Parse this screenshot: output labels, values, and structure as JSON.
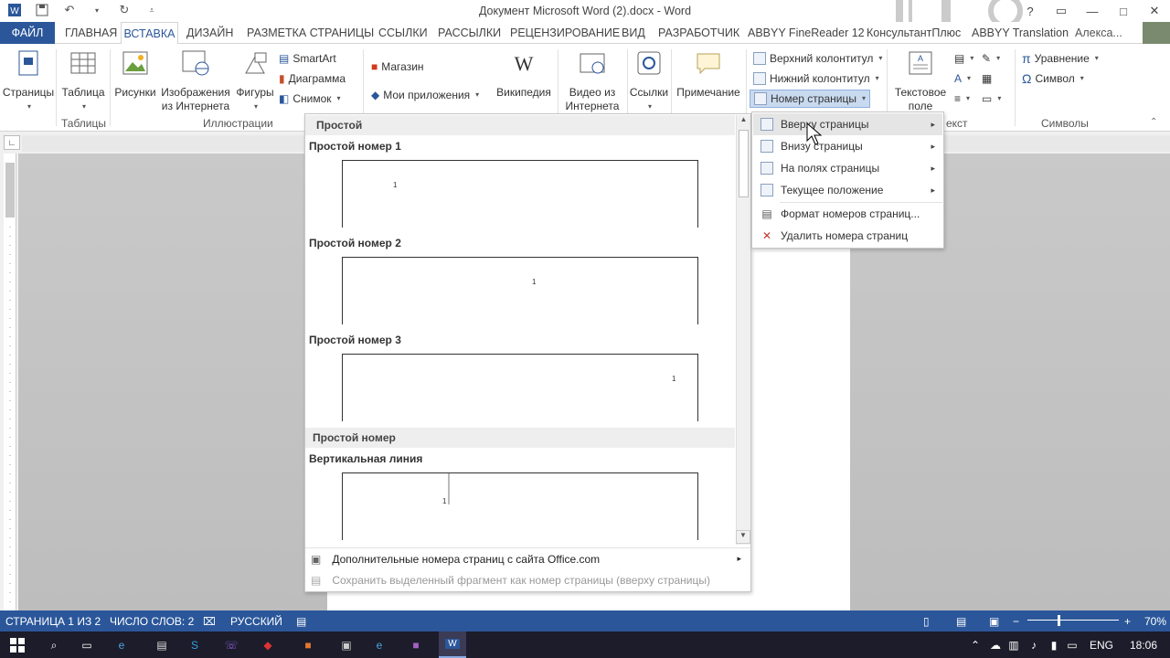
{
  "window": {
    "title": "Документ Microsoft Word (2).docx - Word",
    "controls": {
      "help": "?",
      "restore": "▭",
      "minimize": "—",
      "maximize": "□",
      "close": "✕"
    }
  },
  "quick_access": {
    "save_icon": "save-icon",
    "undo_icon": "undo-icon",
    "redo_icon": "redo-icon",
    "customize_icon": "customize-icon"
  },
  "tabs": {
    "file": "ФАЙЛ",
    "home": "ГЛАВНАЯ",
    "insert": "ВСТАВКА",
    "design": "ДИЗАЙН",
    "layout": "РАЗМЕТКА СТРАНИЦЫ",
    "references": "ССЫЛКИ",
    "mailings": "РАССЫЛКИ",
    "review": "РЕЦЕНЗИРОВАНИЕ",
    "view": "ВИД",
    "developer": "РАЗРАБОТЧИК",
    "abbyy_reader": "ABBYY FineReader 12",
    "consultant": "КонсультантПлюс",
    "abbyy_translation": "ABBYY Translation",
    "user": "Алекса..."
  },
  "ribbon": {
    "pages": {
      "label": "Страницы"
    },
    "tables_group": {
      "table": "Таблица",
      "group_label": "Таблицы"
    },
    "illustrations": {
      "pictures": "Рисунки",
      "online_pictures_1": "Изображения",
      "online_pictures_2": "из Интернета",
      "shapes": "Фигуры",
      "smartart": "SmartArt",
      "chart": "Диаграмма",
      "screenshot": "Снимок",
      "group_label": "Иллюстрации"
    },
    "apps": {
      "store": "Магазин",
      "my_apps": "Мои приложения",
      "wikipedia": "Википедия"
    },
    "media": {
      "video_1": "Видео из",
      "video_2": "Интернета"
    },
    "links": {
      "label": "Ссылки"
    },
    "comments": {
      "label": "Примечание"
    },
    "header_footer": {
      "header": "Верхний колонтитул",
      "footer": "Нижний колонтитул",
      "page_number": "Номер страницы"
    },
    "text": {
      "textbox_1": "Текстовое",
      "textbox_2": "поле",
      "group_label_tail": "екст"
    },
    "symbols": {
      "equation": "Уравнение",
      "symbol": "Символ",
      "group_label": "Символы"
    }
  },
  "gallery": {
    "section1": "Простой",
    "items": [
      {
        "title": "Простой номер 1",
        "num": "1"
      },
      {
        "title": "Простой номер 2",
        "num": "1"
      },
      {
        "title": "Простой номер 3",
        "num": "1"
      }
    ],
    "section2": "Простой номер",
    "item4": {
      "title": "Вертикальная линия",
      "num": "1"
    },
    "footer_more": "Дополнительные номера страниц с сайта Office.com",
    "footer_save": "Сохранить выделенный фрагмент как номер страницы (вверху страницы)"
  },
  "submenu": {
    "items": [
      {
        "label": "Вверху страницы"
      },
      {
        "label": "Внизу страницы"
      },
      {
        "label": "На полях страницы"
      },
      {
        "label": "Текущее положение"
      },
      {
        "label": "Формат номеров страниц..."
      },
      {
        "label": "Удалить номера страниц"
      }
    ]
  },
  "status": {
    "page": "СТРАНИЦА 1 ИЗ 2",
    "words": "ЧИСЛО СЛОВ: 2",
    "language": "РУССКИЙ",
    "zoom": "70%"
  },
  "taskbar": {
    "language": "ENG",
    "time": "18:06"
  },
  "colors": {
    "accent": "#2b579a",
    "taskbar": "#1c1c2a"
  }
}
